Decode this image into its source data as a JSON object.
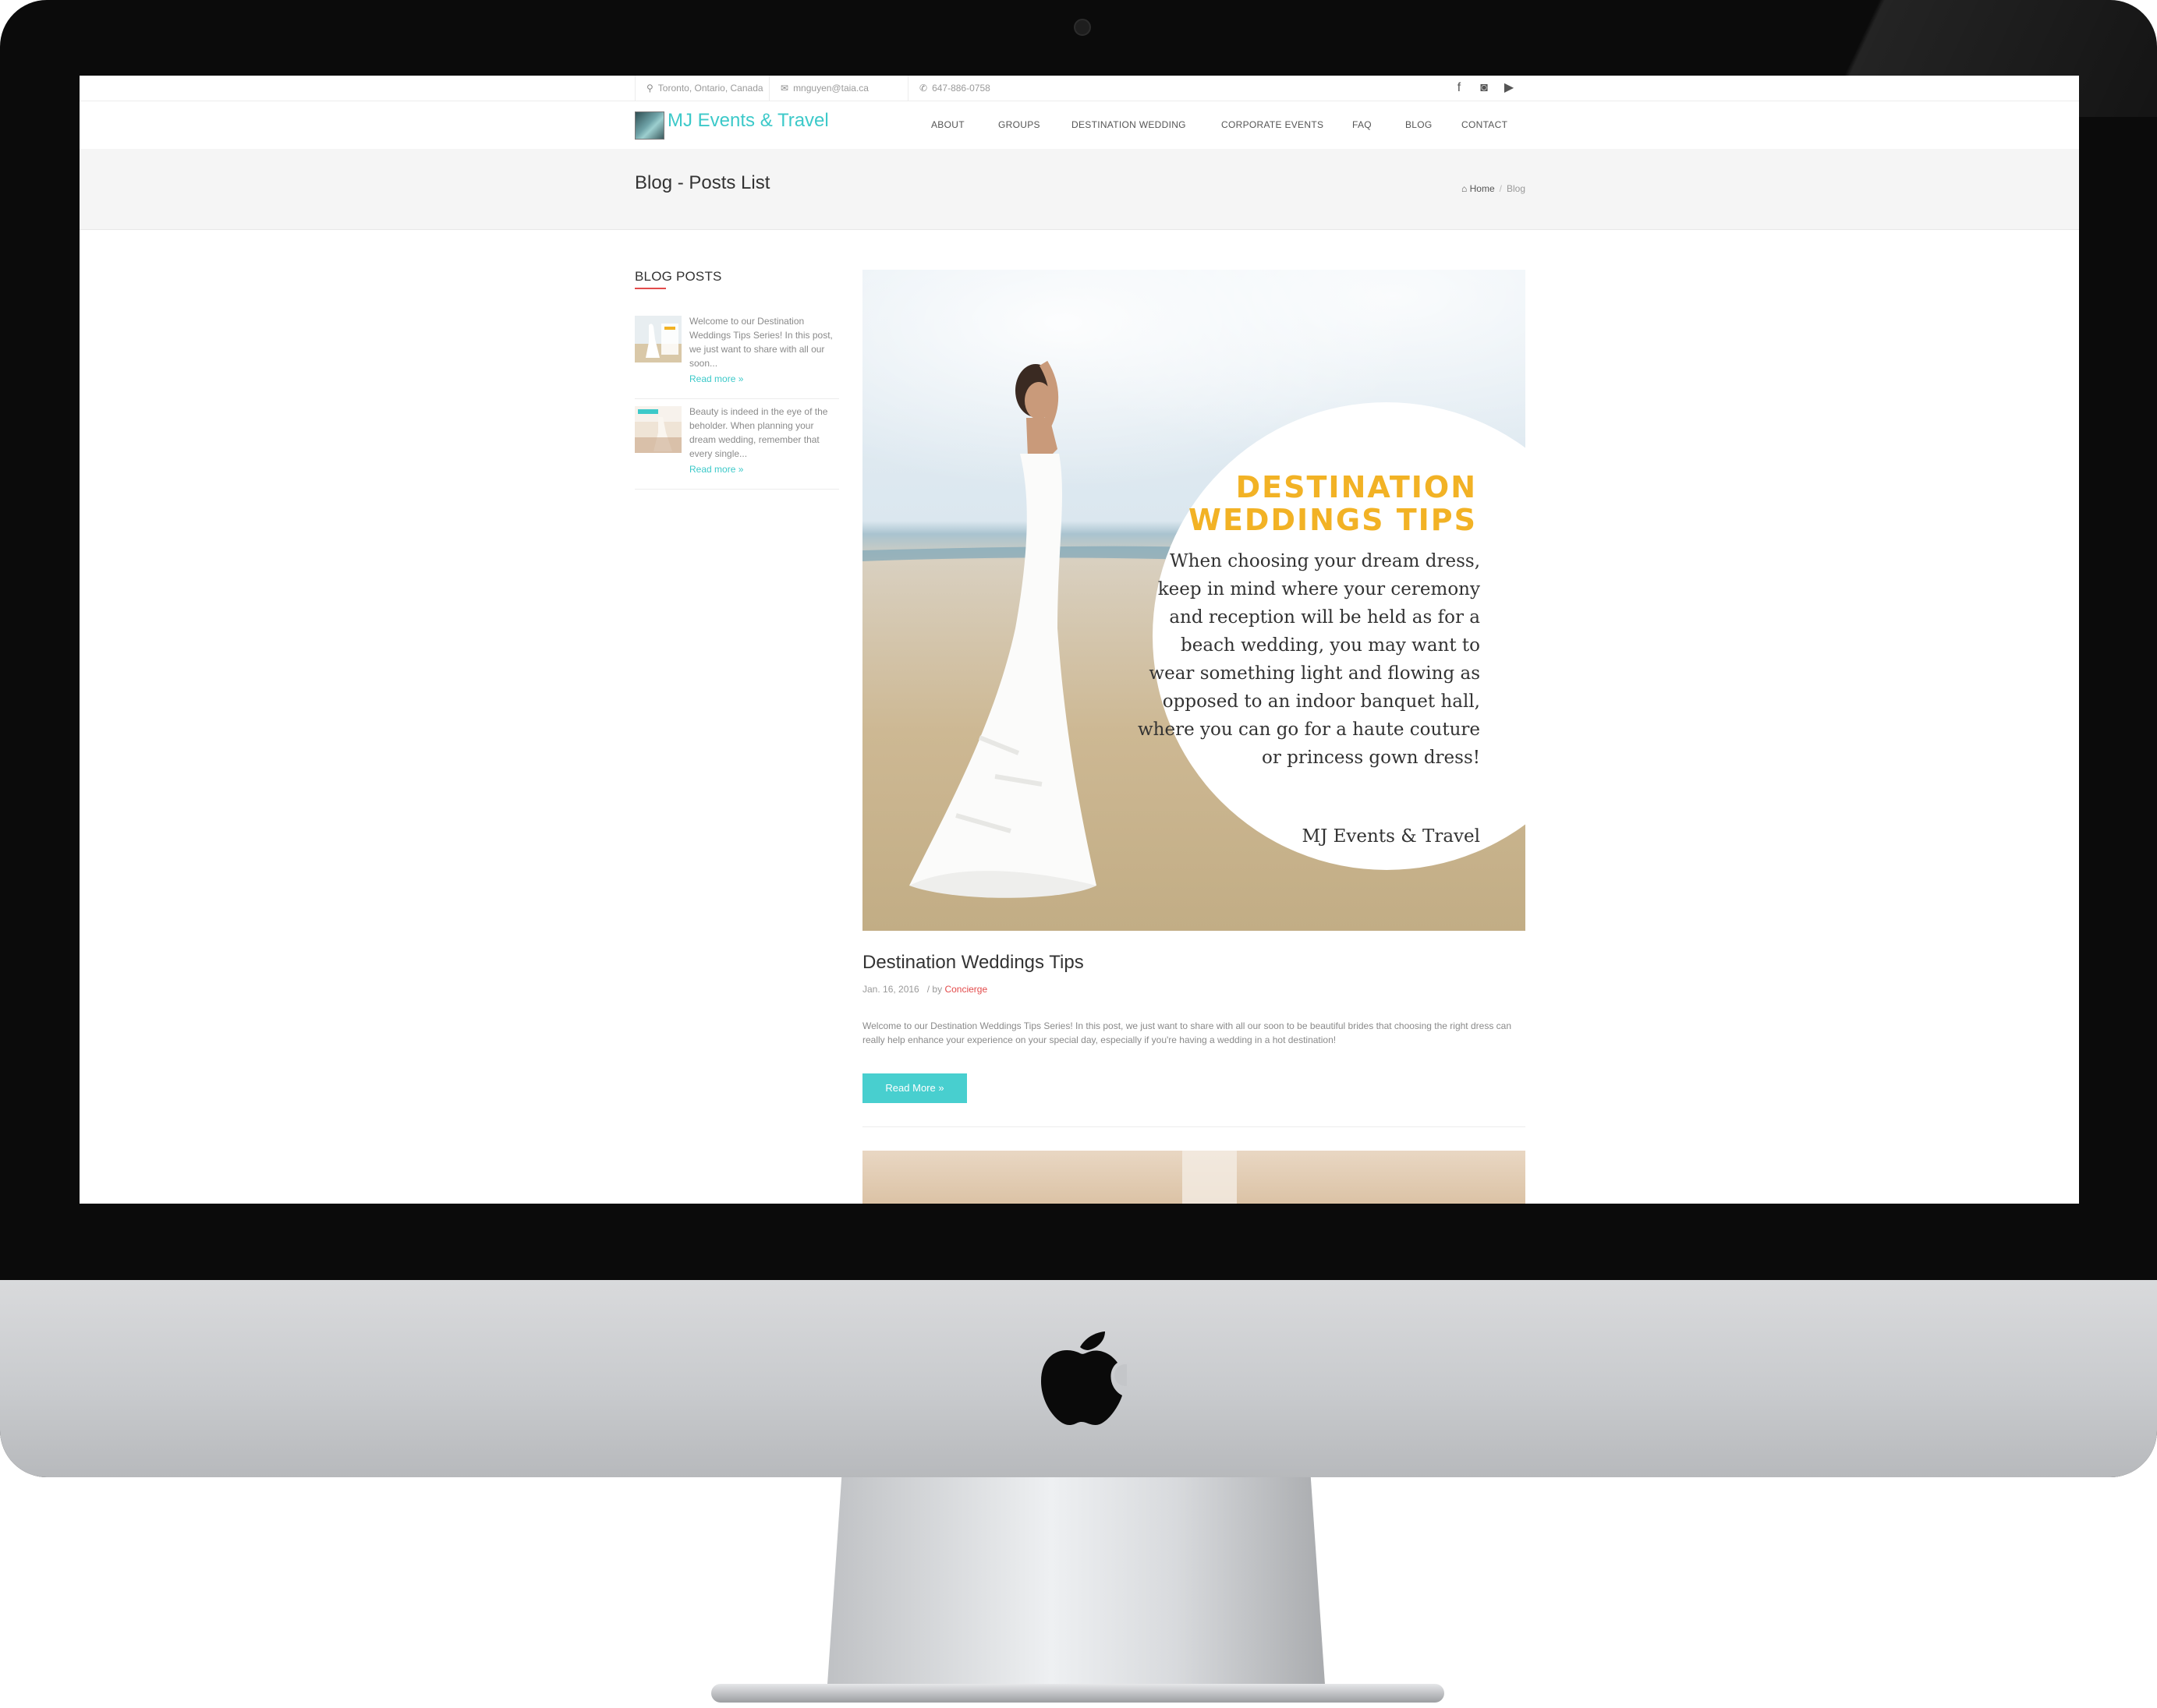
{
  "topbar": {
    "location": "Toronto, Ontario, Canada",
    "email": "mnguyen@taia.ca",
    "phone": "647-886-0758"
  },
  "brand": {
    "name": "MJ Events & Travel"
  },
  "nav": {
    "items": [
      "ABOUT",
      "GROUPS",
      "DESTINATION WEDDING",
      "CORPORATE EVENTS",
      "FAQ",
      "BLOG",
      "CONTACT"
    ]
  },
  "page": {
    "title": "Blog - Posts List"
  },
  "breadcrumb": {
    "home": "Home",
    "current": "Blog"
  },
  "sidebar": {
    "heading": "BLOG POSTS",
    "posts": [
      {
        "excerpt": "Welcome to our Destination Weddings Tips Series! In this post, we just want to share with all our soon...",
        "link": "Read more »"
      },
      {
        "excerpt": "Beauty is indeed in the eye of the beholder. When planning your dream wedding, remember that every single...",
        "link": "Read more »"
      }
    ]
  },
  "post": {
    "image": {
      "title": "DESTINATION WEDDINGS TIPS",
      "body": "When choosing your dream dress, keep in mind where your ceremony and reception will be held as for a beach wedding, you may want to wear something light and flowing as opposed to an indoor banquet hall,  where you can go for a haute couture or princess gown dress!",
      "signature": "MJ Events & Travel"
    },
    "title": "Destination Weddings Tips",
    "date": "Jan. 16, 2016",
    "by": "/ by",
    "author": "Concierge",
    "excerpt": "Welcome to our Destination Weddings Tips Series! In this post, we just want to share with all our soon to be beautiful brides that choosing the right dress can really help enhance your experience on your special day, especially if you're having a wedding in a hot destination!",
    "read_more": "Read More »"
  },
  "colors": {
    "accent": "#3cc9c9",
    "button": "#48cfcf",
    "highlight": "#e34b4b",
    "image_title": "#f2b225"
  },
  "icons": [
    "map-marker-icon",
    "envelope-icon",
    "phone-icon",
    "facebook-icon",
    "instagram-icon",
    "youtube-icon",
    "home-icon",
    "apple-logo-icon"
  ]
}
